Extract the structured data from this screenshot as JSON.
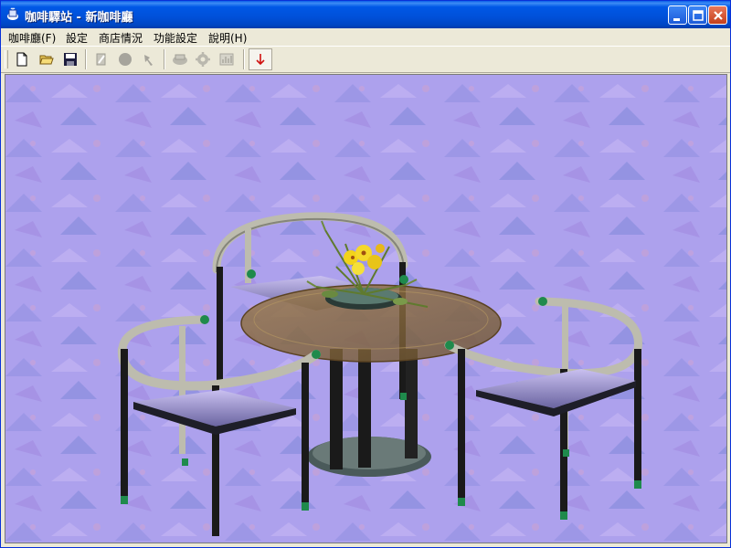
{
  "window": {
    "title": "咖啡驛站 - 新咖啡廳"
  },
  "menu": [
    {
      "label": "咖啡廳(F)"
    },
    {
      "label": "設定"
    },
    {
      "label": "商店情況"
    },
    {
      "label": "功能設定"
    },
    {
      "label": "說明(H)"
    }
  ],
  "toolbar": {
    "buttons": [
      {
        "icon": "new-document-icon",
        "enabled": true
      },
      {
        "icon": "open-folder-icon",
        "enabled": true
      },
      {
        "icon": "save-disk-icon",
        "enabled": true
      },
      {
        "icon": "tool-disabled-icon",
        "enabled": false
      },
      {
        "icon": "circle-disabled-icon",
        "enabled": false
      },
      {
        "icon": "arrow-disabled-icon",
        "enabled": false
      },
      {
        "icon": "coffee-machine-disabled-icon",
        "enabled": false
      },
      {
        "icon": "gear-disabled-icon",
        "enabled": false
      },
      {
        "icon": "chart-disabled-icon",
        "enabled": false
      },
      {
        "icon": "red-down-arrow-icon",
        "enabled": true,
        "pressed": true
      }
    ]
  },
  "scene": {
    "description_colors": {
      "floor": "#a99ee8",
      "chair_frame": "#b8b8a8",
      "chair_legs": "#1a1a1a",
      "chair_feet": "#1f8a4c",
      "table_glass": "#8a6a3a",
      "flowers": "#f2d21a"
    }
  }
}
